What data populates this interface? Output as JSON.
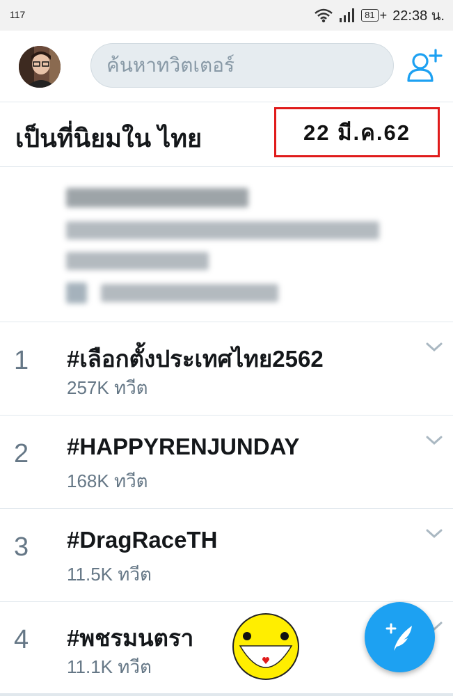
{
  "status_bar": {
    "left_text": "117",
    "battery": "81",
    "time": "22:38 น."
  },
  "header": {
    "search_placeholder": "ค้นหาทวิตเตอร์",
    "avatar_icon": "user-avatar",
    "add_user_icon": "add-user-icon"
  },
  "trends": {
    "title": "เป็นที่นิยมใน ไทย",
    "date_note": "22 มี.ค.62",
    "items": [
      {
        "rank": "1",
        "name": "#เลือกตั้งประเทศไทย2562",
        "count": "257K ทวีต"
      },
      {
        "rank": "2",
        "name": "#HAPPYRENJUNDAY",
        "count": "168K ทวีต"
      },
      {
        "rank": "3",
        "name": "#DragRaceTH",
        "count": "11.5K ทวีต"
      },
      {
        "rank": "4",
        "name": "#พชรมนตรา",
        "count": "11.1K ทวีต"
      }
    ]
  },
  "colors": {
    "accent": "#1da1f2",
    "highlight_box": "#e01b1b",
    "secondary_text": "#657786"
  }
}
